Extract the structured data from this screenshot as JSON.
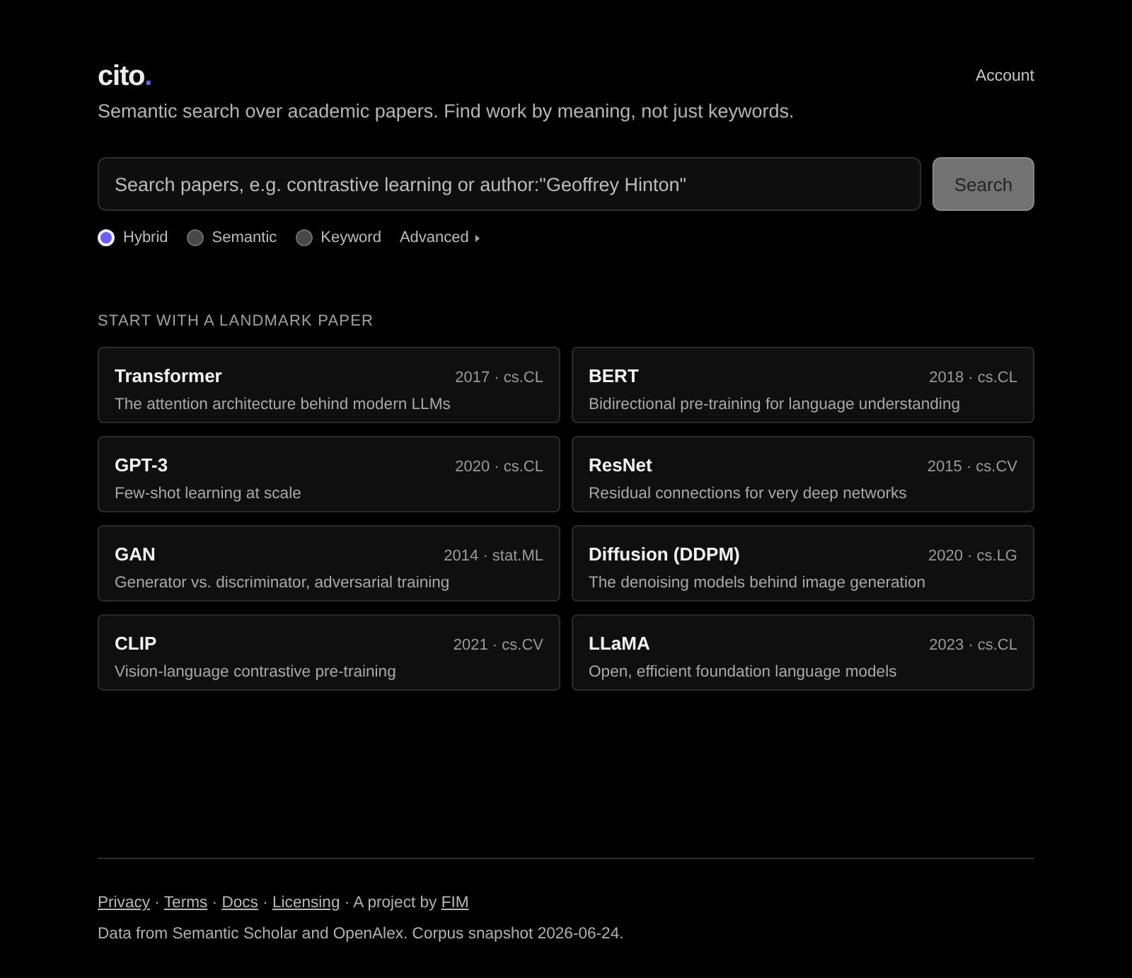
{
  "header": {
    "logo": {
      "text": "cito",
      "accent": "."
    },
    "account": "Account"
  },
  "tagline": "Semantic search over academic papers. Find work by meaning, not just keywords.",
  "search": {
    "placeholder": "Search papers, e.g. contrastive learning or author:\"Geoffrey Hinton\"",
    "button": "Search"
  },
  "modes": [
    {
      "label": "Hybrid",
      "selected": true
    },
    {
      "label": "Semantic",
      "selected": false
    },
    {
      "label": "Keyword",
      "selected": false
    }
  ],
  "advanced": {
    "label": "Advanced",
    "expanded": false
  },
  "landmarks": {
    "heading": "START WITH A LANDMARK PAPER",
    "papers": [
      {
        "title": "Transformer",
        "meta": "2017 · cs.CL",
        "description": "The attention architecture behind modern LLMs"
      },
      {
        "title": "BERT",
        "meta": "2018 · cs.CL",
        "description": "Bidirectional pre-training for language understanding"
      },
      {
        "title": "GPT-3",
        "meta": "2020 · cs.CL",
        "description": "Few-shot learning at scale"
      },
      {
        "title": "ResNet",
        "meta": "2015 · cs.CV",
        "description": "Residual connections for very deep networks"
      },
      {
        "title": "GAN",
        "meta": "2014 · stat.ML",
        "description": "Generator vs. discriminator, adversarial training"
      },
      {
        "title": "Diffusion (DDPM)",
        "meta": "2020 · cs.LG",
        "description": "The denoising models behind image generation"
      },
      {
        "title": "CLIP",
        "meta": "2021 · cs.CV",
        "description": "Vision-language contrastive pre-training"
      },
      {
        "title": "LLaMA",
        "meta": "2023 · cs.CL",
        "description": "Open, efficient foundation language models"
      }
    ]
  },
  "footer": {
    "links": [
      "Privacy",
      "Terms",
      "Docs",
      "Licensing"
    ],
    "separator": "·",
    "credit": "A project by",
    "credit_link": "FIM",
    "note": "Data from Semantic Scholar and OpenAlex. Corpus snapshot 2026-06-24."
  }
}
